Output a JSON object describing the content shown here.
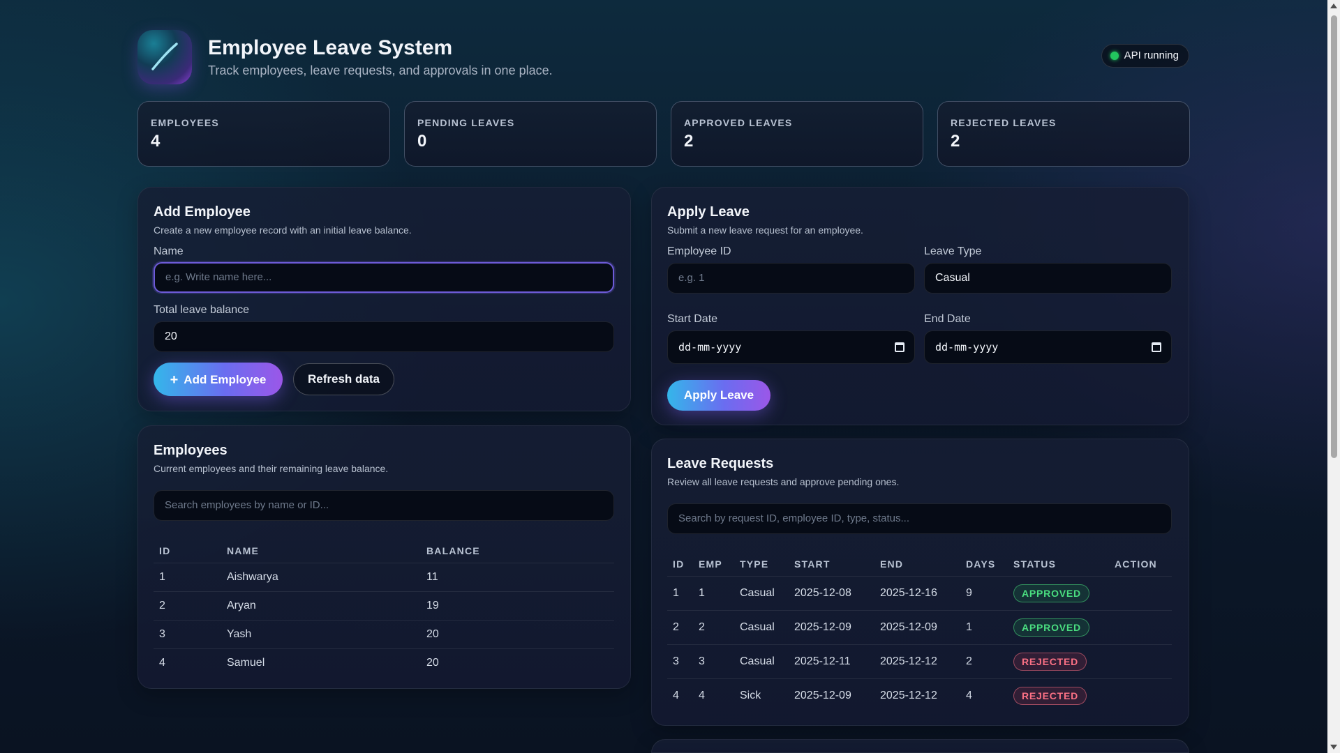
{
  "header": {
    "title": "Employee Leave System",
    "subtitle": "Track employees, leave requests, and approvals in one place.",
    "api_status": "API running",
    "logo_icon": "slash-logo-icon"
  },
  "stats": [
    {
      "label": "EMPLOYEES",
      "value": "4"
    },
    {
      "label": "PENDING LEAVES",
      "value": "0"
    },
    {
      "label": "APPROVED LEAVES",
      "value": "2"
    },
    {
      "label": "REJECTED LEAVES",
      "value": "2"
    }
  ],
  "add_employee": {
    "title": "Add Employee",
    "subtitle": "Create a new employee record with an initial leave balance.",
    "name_label": "Name",
    "name_placeholder": "e.g. Write name here...",
    "balance_label": "Total leave balance",
    "balance_value": "20",
    "add_button": "Add Employee",
    "add_icon": "+",
    "refresh_button": "Refresh data"
  },
  "apply_leave": {
    "title": "Apply Leave",
    "subtitle": "Submit a new leave request for an employee.",
    "employee_id_label": "Employee ID",
    "employee_id_placeholder": "e.g. 1",
    "leave_type_label": "Leave Type",
    "leave_type_value": "Casual",
    "start_label": "Start Date",
    "start_value": "dd-mm-yyyy",
    "end_label": "End Date",
    "end_value": "dd-mm-yyyy",
    "apply_button": "Apply Leave"
  },
  "employees": {
    "title": "Employees",
    "subtitle": "Current employees and their remaining leave balance.",
    "search_placeholder": "Search employees by name or ID...",
    "columns": [
      "ID",
      "NAME",
      "BALANCE"
    ],
    "rows": [
      [
        "1",
        "Aishwarya",
        "11"
      ],
      [
        "2",
        "Aryan",
        "19"
      ],
      [
        "3",
        "Yash",
        "20"
      ],
      [
        "4",
        "Samuel",
        "20"
      ]
    ]
  },
  "leave_requests": {
    "title": "Leave Requests",
    "subtitle": "Review all leave requests and approve pending ones.",
    "search_placeholder": "Search by request ID, employee ID, type, status...",
    "columns": [
      "ID",
      "EMP",
      "TYPE",
      "START",
      "END",
      "DAYS",
      "STATUS",
      "ACTION"
    ],
    "rows": [
      [
        "1",
        "1",
        "Casual",
        "2025-12-08",
        "2025-12-16",
        "9",
        "APPROVED",
        ""
      ],
      [
        "2",
        "2",
        "Casual",
        "2025-12-09",
        "2025-12-09",
        "1",
        "APPROVED",
        ""
      ],
      [
        "3",
        "3",
        "Casual",
        "2025-12-11",
        "2025-12-12",
        "2",
        "REJECTED",
        ""
      ],
      [
        "4",
        "4",
        "Sick",
        "2025-12-09",
        "2025-12-12",
        "4",
        "REJECTED",
        ""
      ]
    ]
  },
  "colors": {
    "approved": "#4ade80",
    "rejected": "#fb7185",
    "accent_start": "#34b6ea",
    "accent_end": "#9b57e8"
  }
}
